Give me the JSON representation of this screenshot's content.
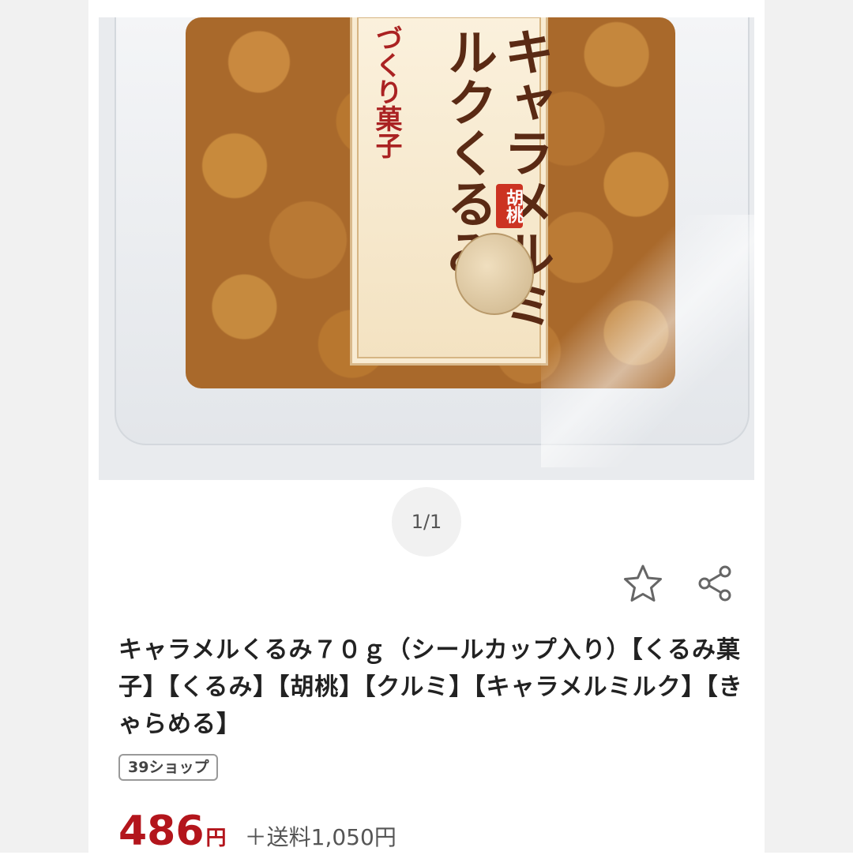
{
  "gallery": {
    "label_small": "づくり菓子",
    "label_main": "キャラメルミルクくるみ",
    "label_stamp": "胡桃",
    "counter": "1/1"
  },
  "actions": {
    "favorite_icon": "star-outline-icon",
    "share_icon": "share-icon"
  },
  "product": {
    "title": "キャラメルくるみ７０ｇ（シールカップ入り）【くるみ菓子】【くるみ】【胡桃】【クルミ】【キャラメルミルク】【きゃらめる】",
    "shop_badge": "39ショップ",
    "price": "486",
    "price_unit": "円",
    "shipping": "＋送料1,050円"
  },
  "colors": {
    "price": "#b3151c",
    "side_panels": "#f1f1f1"
  }
}
